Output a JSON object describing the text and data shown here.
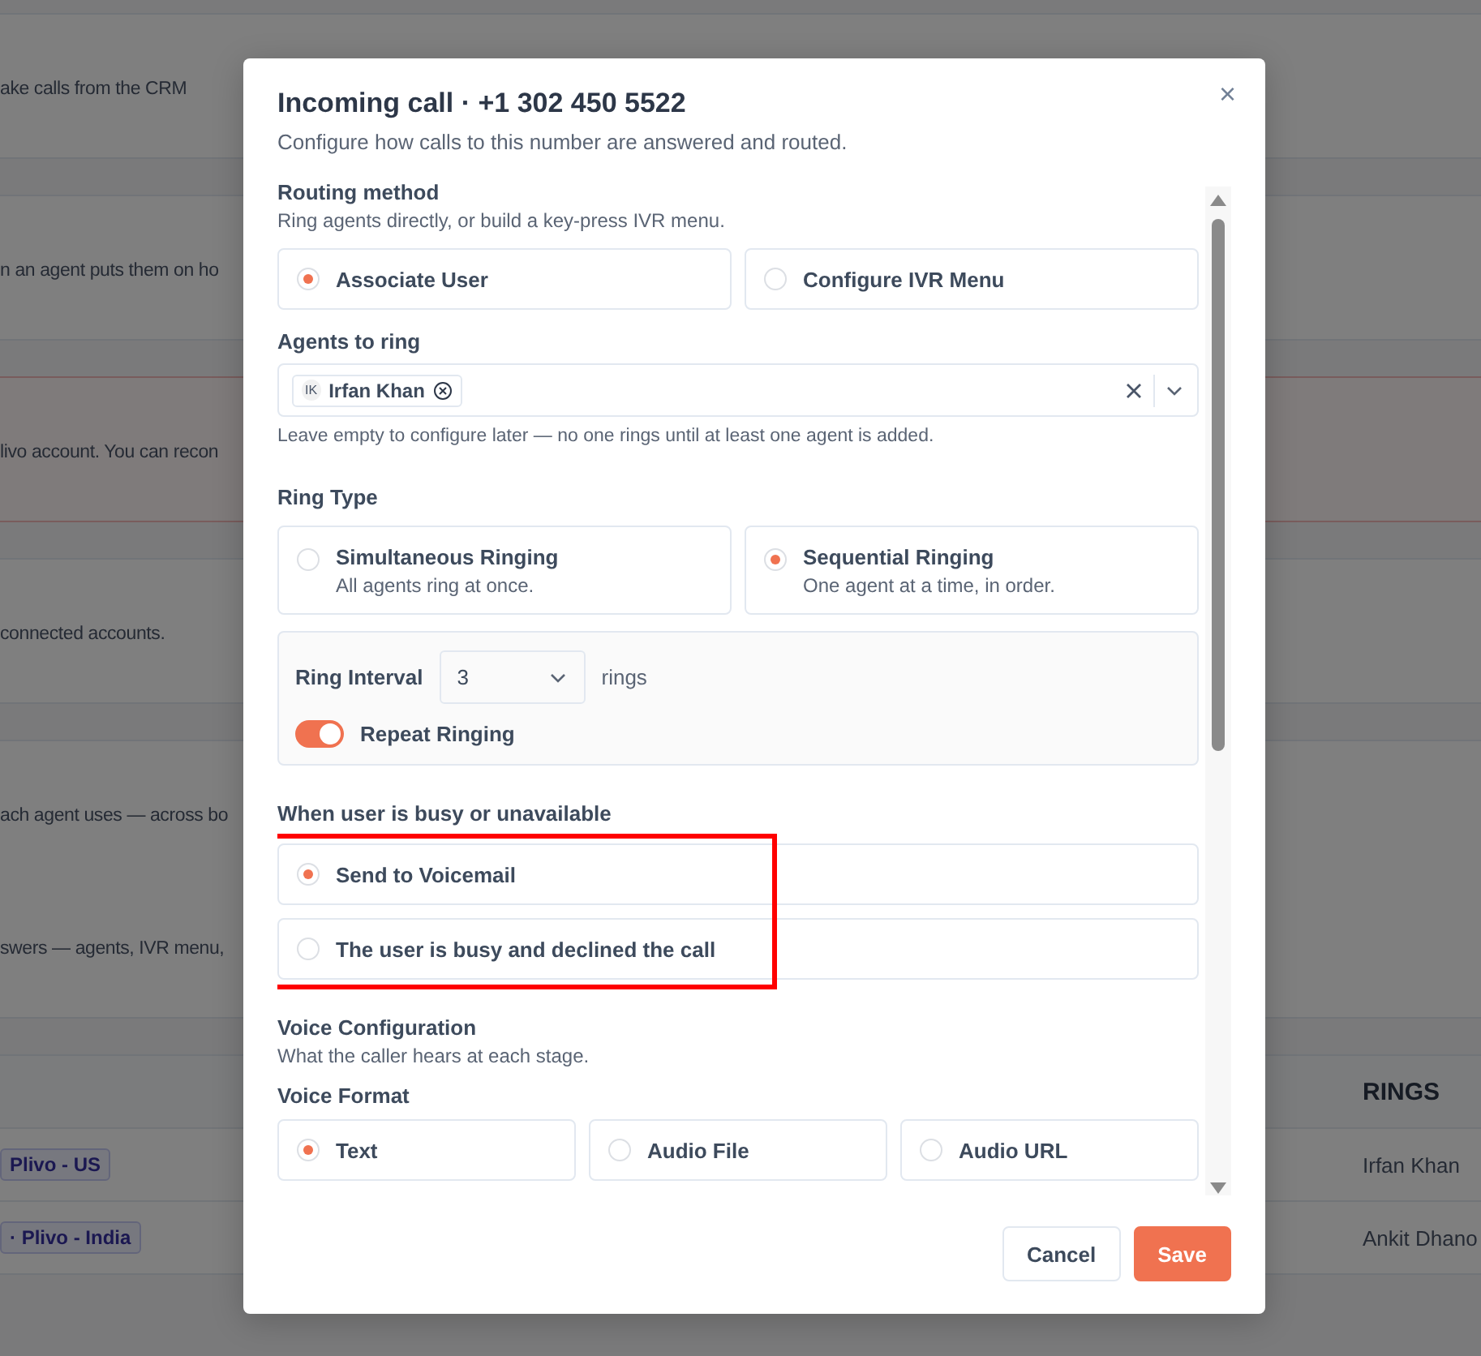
{
  "background": {
    "sections": [
      {
        "kind": "card",
        "lines": [
          "ake calls from the CRM"
        ]
      },
      {
        "kind": "card",
        "lines": [
          "n an agent puts them on ho"
        ]
      },
      {
        "kind": "alert",
        "lines": [
          "livo account. You can recon"
        ]
      },
      {
        "kind": "card",
        "lines": [
          "connected accounts."
        ]
      },
      {
        "kind": "card",
        "lines": [
          "ach agent uses — across bo",
          "swers — agents, IVR menu,"
        ]
      }
    ],
    "table": {
      "header": "RINGS",
      "rows": [
        {
          "tag": "Plivo - US",
          "rings": "Irfan Khan"
        },
        {
          "tag": "· Plivo - India",
          "rings": "Ankit Dhano"
        }
      ]
    }
  },
  "dialog": {
    "title": "Incoming call · +1 302 450 5522",
    "subtitle": "Configure how calls to this number are answered and routed.",
    "close": "×",
    "routing": {
      "title": "Routing method",
      "description": "Ring agents directly, or build a key-press IVR menu.",
      "options": [
        {
          "label": "Associate User",
          "selected": true
        },
        {
          "label": "Configure IVR Menu",
          "selected": false
        }
      ]
    },
    "agents": {
      "label": "Agents to ring",
      "chips": [
        {
          "initials": "IK",
          "name": "Irfan Khan"
        }
      ],
      "hint": "Leave empty to configure later — no one rings until at least one agent is added."
    },
    "ring_type": {
      "title": "Ring Type",
      "options": [
        {
          "label": "Simultaneous Ringing",
          "description": "All agents ring at once.",
          "selected": false
        },
        {
          "label": "Sequential Ringing",
          "description": "One agent at a time, in order.",
          "selected": true
        }
      ]
    },
    "ring_interval": {
      "label": "Ring Interval",
      "value": "3",
      "unit": "rings"
    },
    "repeat": {
      "label": "Repeat Ringing",
      "on": true
    },
    "busy": {
      "title": "When user is busy or unavailable",
      "highlighted": true,
      "options": [
        {
          "label": "Send to Voicemail",
          "selected": true
        },
        {
          "label": "The user is busy and declined the call",
          "selected": false
        }
      ]
    },
    "voice": {
      "title": "Voice Configuration",
      "description": "What the caller hears at each stage."
    },
    "voice_format": {
      "title": "Voice Format",
      "options": [
        {
          "label": "Text",
          "selected": true
        },
        {
          "label": "Audio File",
          "selected": false
        },
        {
          "label": "Audio URL",
          "selected": false
        }
      ]
    },
    "buttons": [
      {
        "kind": "secondary",
        "label": "Cancel"
      },
      {
        "kind": "primary",
        "label": "Save"
      }
    ]
  }
}
